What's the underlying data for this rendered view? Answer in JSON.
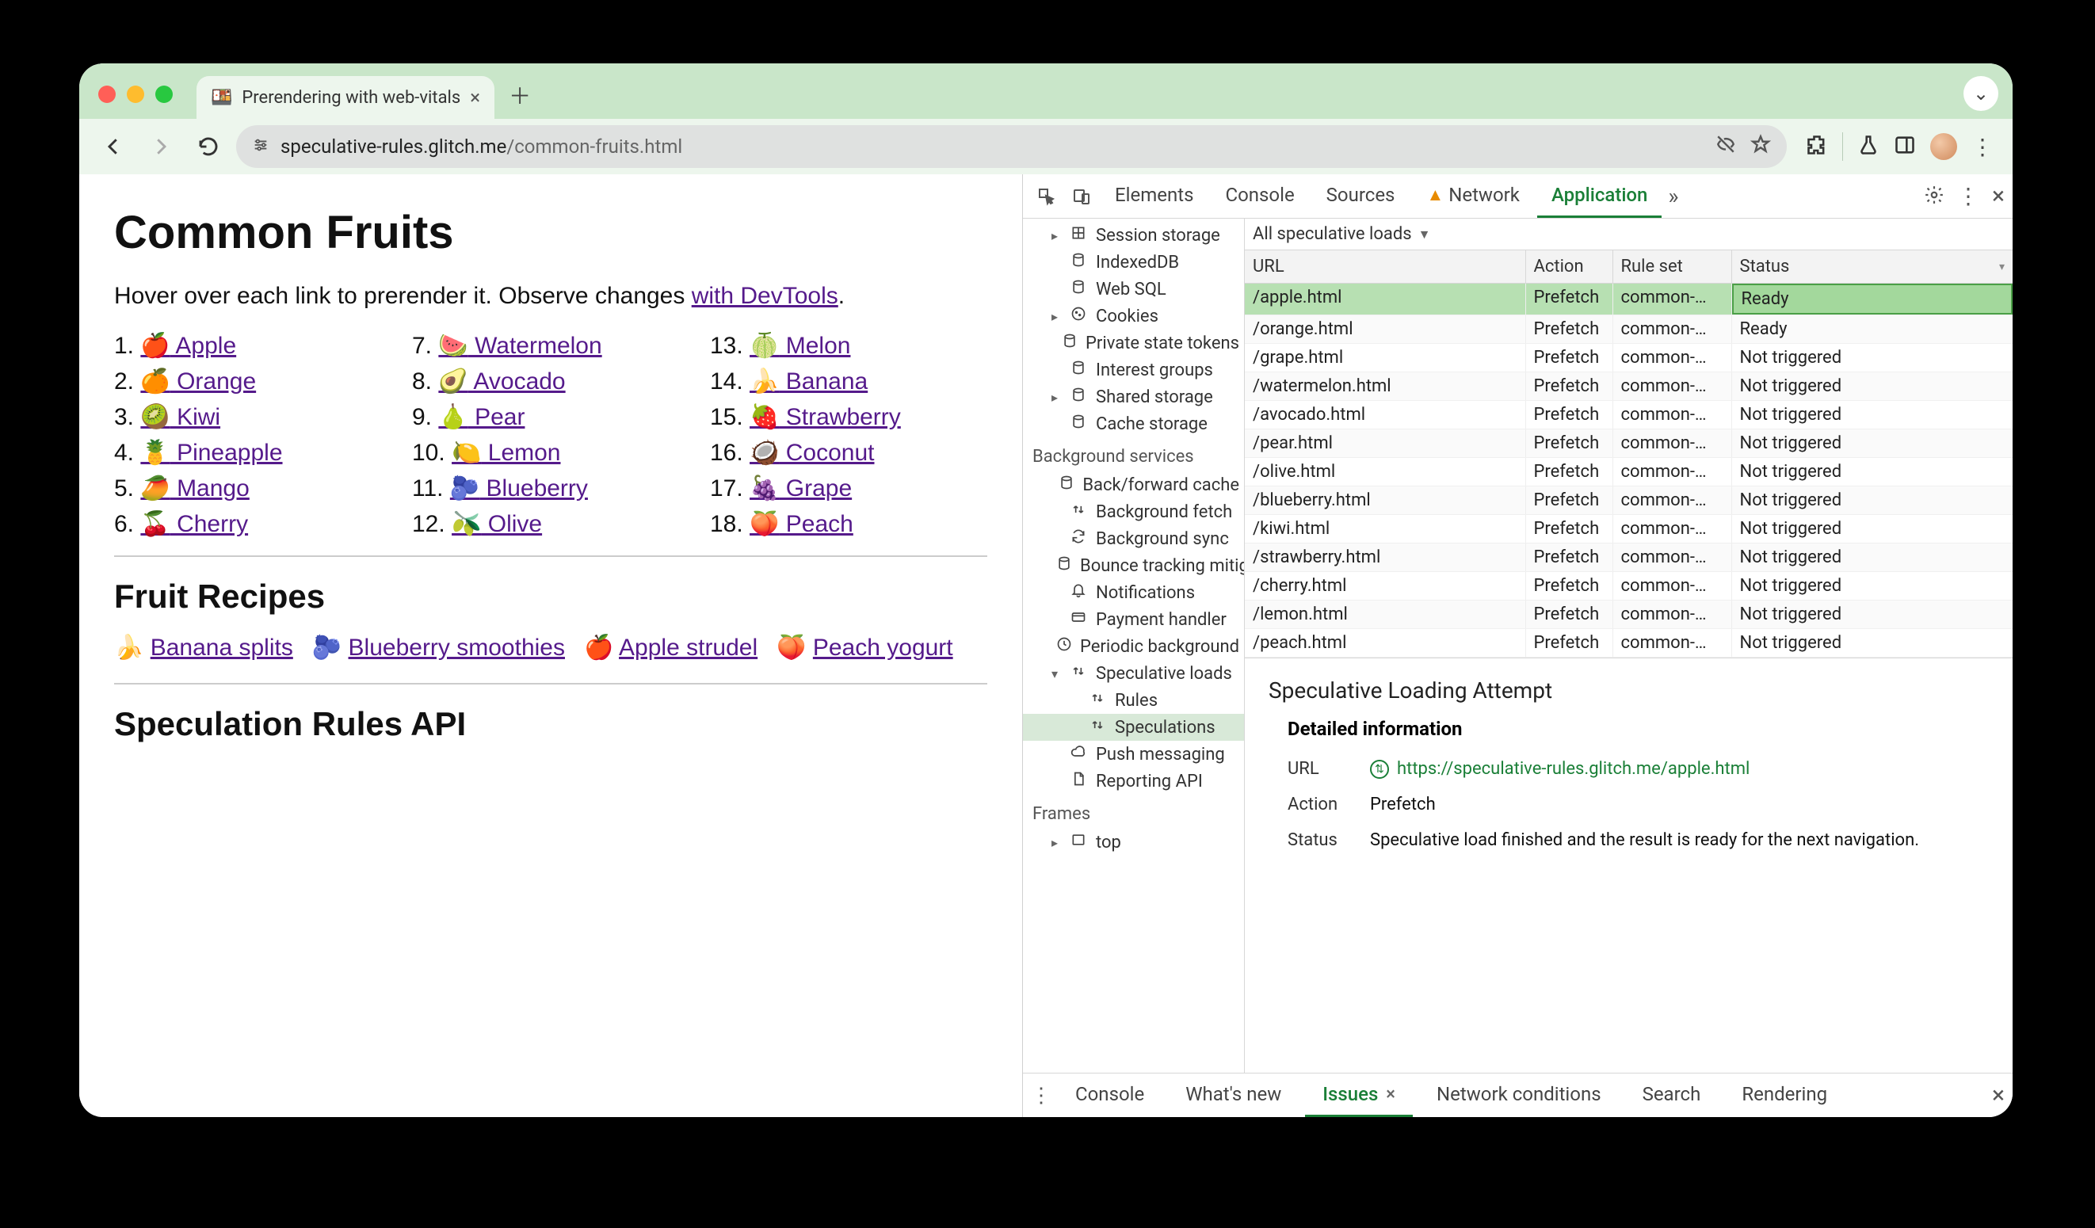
{
  "window": {
    "tab_title": "Prerendering with web-vitals",
    "url_host": "speculative-rules.glitch.me",
    "url_path": "/common-fruits.html"
  },
  "page": {
    "h1": "Common Fruits",
    "lead_prefix": "Hover over each link to prerender it. Observe changes ",
    "lead_link": "with DevTools",
    "lead_suffix": ".",
    "fruits": [
      {
        "n": "1.",
        "e": "🍎",
        "t": "Apple"
      },
      {
        "n": "2.",
        "e": "🍊",
        "t": "Orange"
      },
      {
        "n": "3.",
        "e": "🥝",
        "t": "Kiwi"
      },
      {
        "n": "4.",
        "e": "🍍",
        "t": "Pineapple"
      },
      {
        "n": "5.",
        "e": "🥭",
        "t": "Mango"
      },
      {
        "n": "6.",
        "e": "🍒",
        "t": "Cherry"
      },
      {
        "n": "7.",
        "e": "🍉",
        "t": "Watermelon"
      },
      {
        "n": "8.",
        "e": "🥑",
        "t": "Avocado"
      },
      {
        "n": "9.",
        "e": "🍐",
        "t": "Pear"
      },
      {
        "n": "10.",
        "e": "🍋",
        "t": "Lemon"
      },
      {
        "n": "11.",
        "e": "🫐",
        "t": "Blueberry"
      },
      {
        "n": "12.",
        "e": "🫒",
        "t": "Olive"
      },
      {
        "n": "13.",
        "e": "🍈",
        "t": "Melon"
      },
      {
        "n": "14.",
        "e": "🍌",
        "t": "Banana"
      },
      {
        "n": "15.",
        "e": "🍓",
        "t": "Strawberry"
      },
      {
        "n": "16.",
        "e": "🥥",
        "t": "Coconut"
      },
      {
        "n": "17.",
        "e": "🍇",
        "t": "Grape"
      },
      {
        "n": "18.",
        "e": "🍑",
        "t": "Peach"
      }
    ],
    "h2a": "Fruit Recipes",
    "recipes": [
      {
        "e": "🍌",
        "t": "Banana splits"
      },
      {
        "e": "🫐",
        "t": "Blueberry smoothies"
      },
      {
        "e": "🍎",
        "t": "Apple strudel"
      },
      {
        "e": "🍑",
        "t": "Peach yogurt"
      }
    ],
    "h2b": "Speculation Rules API"
  },
  "devtools": {
    "tabs": [
      "Elements",
      "Console",
      "Sources",
      "Network",
      "Application"
    ],
    "active_tab": "Application",
    "more": "»",
    "sidebar": {
      "storage": [
        {
          "arrow": "▸",
          "ico": "grid",
          "label": "Session storage"
        },
        {
          "arrow": "",
          "ico": "db",
          "label": "IndexedDB"
        },
        {
          "arrow": "",
          "ico": "db",
          "label": "Web SQL"
        },
        {
          "arrow": "▸",
          "ico": "cookie",
          "label": "Cookies"
        },
        {
          "arrow": "",
          "ico": "db",
          "label": "Private state tokens"
        },
        {
          "arrow": "",
          "ico": "db",
          "label": "Interest groups"
        },
        {
          "arrow": "▸",
          "ico": "db",
          "label": "Shared storage"
        },
        {
          "arrow": "",
          "ico": "db",
          "label": "Cache storage"
        }
      ],
      "bg_header": "Background services",
      "bg": [
        {
          "ico": "db",
          "label": "Back/forward cache"
        },
        {
          "ico": "updown",
          "label": "Background fetch"
        },
        {
          "ico": "sync",
          "label": "Background sync"
        },
        {
          "ico": "db",
          "label": "Bounce tracking mitigations"
        },
        {
          "ico": "bell",
          "label": "Notifications"
        },
        {
          "ico": "card",
          "label": "Payment handler"
        },
        {
          "ico": "clock",
          "label": "Periodic background sync"
        },
        {
          "ico": "updown",
          "label": "Speculative loads",
          "exp": true
        },
        {
          "ico": "updown",
          "label": "Rules",
          "indent": true
        },
        {
          "ico": "updown",
          "label": "Speculations",
          "indent": true,
          "selected": true
        },
        {
          "ico": "cloud",
          "label": "Push messaging"
        },
        {
          "ico": "file",
          "label": "Reporting API"
        }
      ],
      "frames_header": "Frames",
      "frames": [
        {
          "arrow": "▸",
          "ico": "frame",
          "label": "top"
        }
      ]
    },
    "filter": "All speculative loads",
    "columns": [
      "URL",
      "Action",
      "Rule set",
      "Status"
    ],
    "rows": [
      {
        "url": "/apple.html",
        "action": "Prefetch",
        "ruleset": "common-…",
        "status": "Ready",
        "sel": true
      },
      {
        "url": "/orange.html",
        "action": "Prefetch",
        "ruleset": "common-…",
        "status": "Ready"
      },
      {
        "url": "/grape.html",
        "action": "Prefetch",
        "ruleset": "common-…",
        "status": "Not triggered"
      },
      {
        "url": "/watermelon.html",
        "action": "Prefetch",
        "ruleset": "common-…",
        "status": "Not triggered"
      },
      {
        "url": "/avocado.html",
        "action": "Prefetch",
        "ruleset": "common-…",
        "status": "Not triggered"
      },
      {
        "url": "/pear.html",
        "action": "Prefetch",
        "ruleset": "common-…",
        "status": "Not triggered"
      },
      {
        "url": "/olive.html",
        "action": "Prefetch",
        "ruleset": "common-…",
        "status": "Not triggered"
      },
      {
        "url": "/blueberry.html",
        "action": "Prefetch",
        "ruleset": "common-…",
        "status": "Not triggered"
      },
      {
        "url": "/kiwi.html",
        "action": "Prefetch",
        "ruleset": "common-…",
        "status": "Not triggered"
      },
      {
        "url": "/strawberry.html",
        "action": "Prefetch",
        "ruleset": "common-…",
        "status": "Not triggered"
      },
      {
        "url": "/cherry.html",
        "action": "Prefetch",
        "ruleset": "common-…",
        "status": "Not triggered"
      },
      {
        "url": "/lemon.html",
        "action": "Prefetch",
        "ruleset": "common-…",
        "status": "Not triggered"
      },
      {
        "url": "/peach.html",
        "action": "Prefetch",
        "ruleset": "common-…",
        "status": "Not triggered"
      }
    ],
    "detail": {
      "title": "Speculative Loading Attempt",
      "section": "Detailed information",
      "url_label": "URL",
      "url_value": "https://speculative-rules.glitch.me/apple.html",
      "action_label": "Action",
      "action_value": "Prefetch",
      "status_label": "Status",
      "status_value": "Speculative load finished and the result is ready for the next navigation."
    },
    "drawer": {
      "tabs": [
        "Console",
        "What's new",
        "Issues",
        "Network conditions",
        "Search",
        "Rendering"
      ],
      "active": "Issues"
    }
  }
}
